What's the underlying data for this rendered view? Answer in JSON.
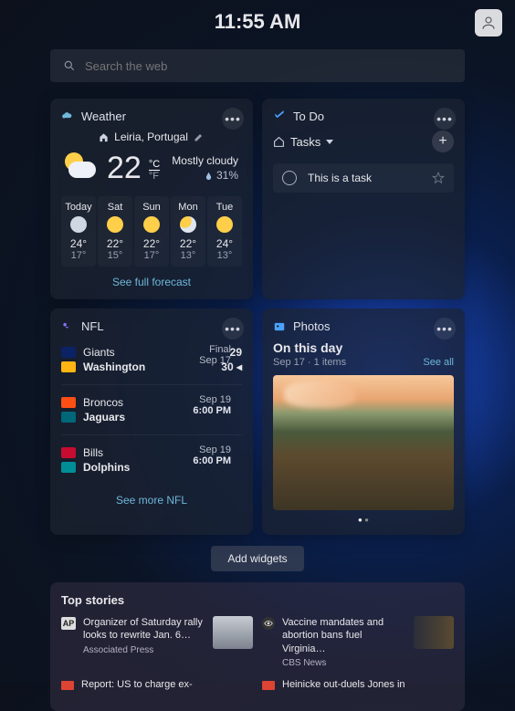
{
  "clock": "11:55 AM",
  "search": {
    "placeholder": "Search the web"
  },
  "weather": {
    "title": "Weather",
    "location": "Leiria, Portugal",
    "temp": "22",
    "unit_c": "°C",
    "unit_f": "°F",
    "condition": "Mostly cloudy",
    "humidity": "31%",
    "forecast": [
      {
        "label": "Today",
        "icon": "cloudy",
        "hi": "24°",
        "lo": "17°"
      },
      {
        "label": "Sat",
        "icon": "sunny",
        "hi": "22°",
        "lo": "15°"
      },
      {
        "label": "Sun",
        "icon": "sunny",
        "hi": "22°",
        "lo": "17°"
      },
      {
        "label": "Mon",
        "icon": "pcloud",
        "hi": "22°",
        "lo": "13°"
      },
      {
        "label": "Tue",
        "icon": "sunny",
        "hi": "24°",
        "lo": "13°"
      }
    ],
    "link": "See full forecast"
  },
  "todo": {
    "title": "To Do",
    "list_label": "Tasks",
    "task": "This is a task"
  },
  "nfl": {
    "title": "NFL",
    "games": [
      {
        "team1": "Giants",
        "score1": "29",
        "logo1": "#0b2265",
        "team2": "Washington",
        "score2": "30",
        "logo2": "#ffb612",
        "status1": "Final",
        "status2": "Sep 17",
        "arrow": true
      },
      {
        "team1": "Broncos",
        "score1": "",
        "logo1": "#fb4f14",
        "team2": "Jaguars",
        "score2": "",
        "logo2": "#006778",
        "status1": "Sep 19",
        "status2": "6:00 PM"
      },
      {
        "team1": "Bills",
        "score1": "",
        "logo1": "#c60c30",
        "team2": "Dolphins",
        "score2": "",
        "logo2": "#008e97",
        "status1": "Sep 19",
        "status2": "6:00 PM"
      }
    ],
    "link": "See more NFL"
  },
  "photos": {
    "title": "Photos",
    "heading": "On this day",
    "meta": "Sep 17 · 1 items",
    "see_all": "See all"
  },
  "add_widgets": "Add widgets",
  "stories": {
    "title": "Top stories",
    "items": [
      {
        "badge": "AP",
        "headline": "Organizer of Saturday rally looks to rewrite Jan. 6…",
        "source": "Associated Press"
      },
      {
        "badge": "eye",
        "headline": "Vaccine mandates and abortion bans fuel Virginia…",
        "source": "CBS News"
      },
      {
        "badge": "red",
        "headline": "Report: US to charge ex-",
        "source": ""
      },
      {
        "badge": "red",
        "headline": "Heinicke out-duels Jones in",
        "source": ""
      }
    ]
  }
}
